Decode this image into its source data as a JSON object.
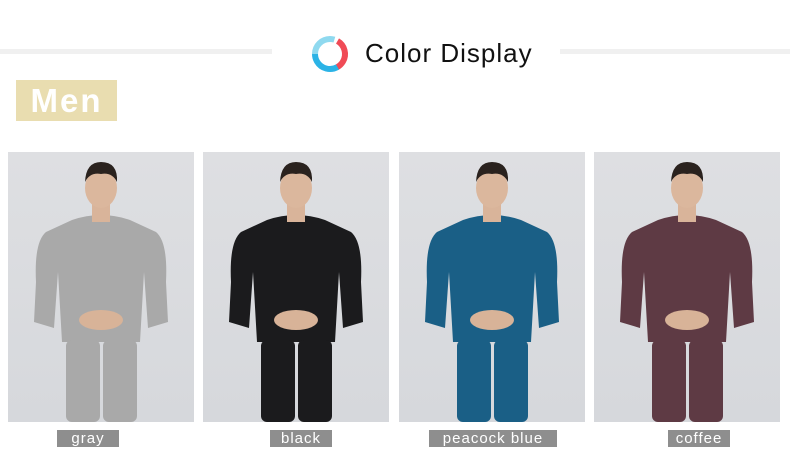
{
  "header": {
    "title": "Color Display",
    "logo_icon": "color-circle-icon"
  },
  "section": {
    "label": "Men"
  },
  "colors": {
    "gray": "#a9a9a9",
    "black": "#1b1b1d",
    "peacock_blue": "#1a5f86",
    "coffee": "#5e3a44",
    "badge": "#e9ddb0",
    "caption_bg": "#8e8e8e"
  },
  "products": [
    {
      "caption": "gray"
    },
    {
      "caption": "black"
    },
    {
      "caption": "peacock blue"
    },
    {
      "caption": "coffee"
    }
  ]
}
